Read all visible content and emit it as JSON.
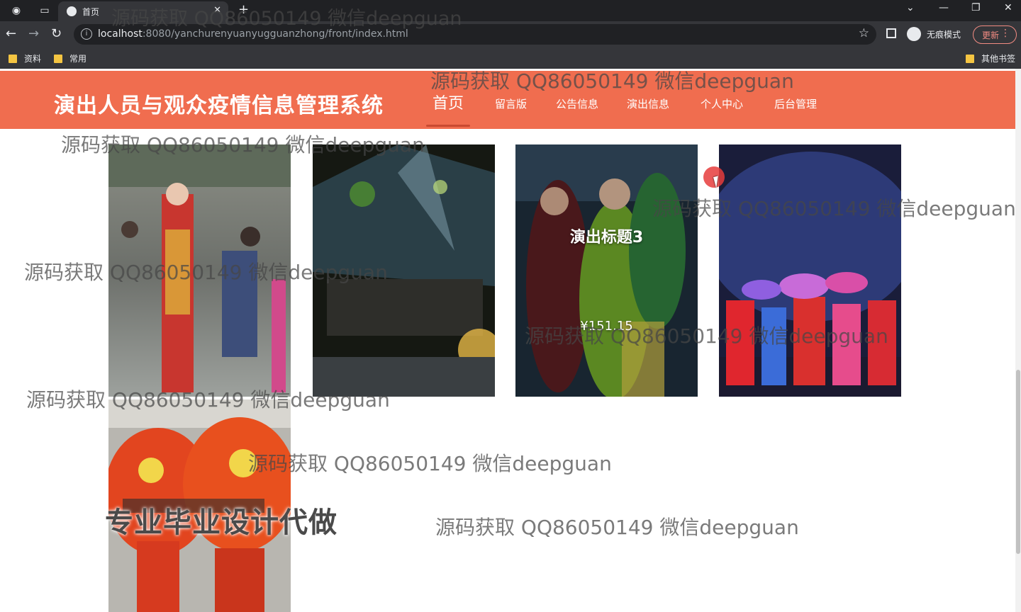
{
  "browser": {
    "tab_title": "首页",
    "url_host": "localhost",
    "url_path": ":8080/yanchurenyuanyugguanzhong/front/index.html",
    "incognito_label": "无痕模式",
    "update_label": "更新",
    "bookmarks": [
      "资料",
      "常用"
    ],
    "other_bookmarks": "其他书签"
  },
  "site": {
    "title": "演出人员与观众疫情信息管理系统",
    "nav": [
      "首页",
      "留言版",
      "公告信息",
      "演出信息",
      "个人中心",
      "后台管理"
    ]
  },
  "cards": [
    {
      "title": "",
      "price": ""
    },
    {
      "title": "",
      "price": ""
    },
    {
      "title": "演出标题3",
      "price": "¥151.15"
    },
    {
      "title": "",
      "price": ""
    },
    {
      "title": "",
      "price": ""
    }
  ],
  "watermarks": {
    "text": "源码获取 QQ86050149 微信deepguan",
    "promo": "专业毕业设计代做"
  },
  "colors": {
    "header": "#f06d4f",
    "browser_dark": "#202124"
  }
}
